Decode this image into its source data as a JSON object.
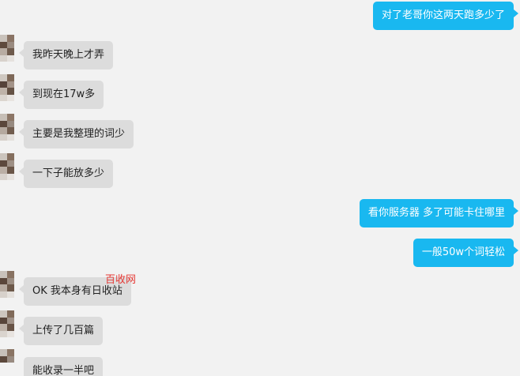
{
  "colors": {
    "background": "#f2f2f2",
    "incoming_bubble": "#dcdcdc",
    "outgoing_bubble": "#19b8f0",
    "watermark": "#e53935"
  },
  "messages": [
    {
      "side": "out",
      "text": "对了老哥你这两天跑多少了"
    },
    {
      "side": "in",
      "text": "我昨天晚上才弄"
    },
    {
      "side": "in",
      "text": "到现在17w多"
    },
    {
      "side": "in",
      "text": "主要是我整理的词少"
    },
    {
      "side": "in",
      "text": "一下子能放多少"
    },
    {
      "side": "out",
      "text": "看你服务器 多了可能卡住哪里"
    },
    {
      "side": "out",
      "text": "一般50w个词轻松"
    },
    {
      "side": "in",
      "text": "OK 我本身有日收站"
    },
    {
      "side": "in",
      "text": "上传了几百篇"
    },
    {
      "side": "in",
      "text": "能收录一半吧"
    }
  ],
  "watermark": "百收网",
  "avatar_icon": "pixelated-avatar-icon"
}
